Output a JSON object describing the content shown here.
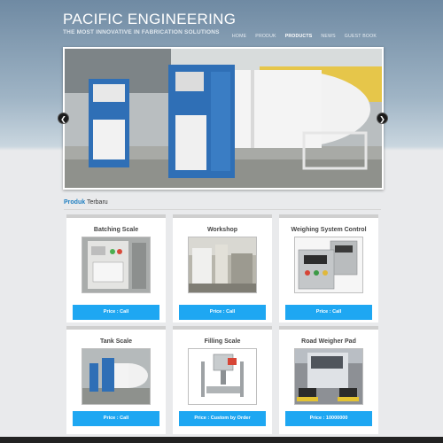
{
  "header": {
    "title": "PACIFIC ENGINEERING",
    "tagline": "THE MOST INNOVATIVE IN FABRICATION SOLUTIONS",
    "nav": [
      "HOME",
      "PRODUK",
      "PRODUCTS",
      "NEWS",
      "GUEST BOOK"
    ],
    "active_nav": "PRODUCTS"
  },
  "slider": {
    "prev_icon": "chevron-left-icon",
    "next_icon": "chevron-right-icon"
  },
  "section": {
    "accent_word": "Produk",
    "title_rest": " Terbaru"
  },
  "products": [
    {
      "name": "Batching Scale",
      "price": "Price : Call"
    },
    {
      "name": "Workshop",
      "price": "Price : Call"
    },
    {
      "name": "Weighing System Control",
      "price": "Price : Call"
    },
    {
      "name": "Tank Scale",
      "price": "Price : Call"
    },
    {
      "name": "Filling Scale",
      "price": "Price : Custom by Order"
    },
    {
      "name": "Road Weigher Pad",
      "price": "Price : 10000000"
    }
  ],
  "colors": {
    "accent": "#1f7fc1",
    "price_button": "#1ea7f2",
    "header_bg": "#8aa2b6"
  }
}
